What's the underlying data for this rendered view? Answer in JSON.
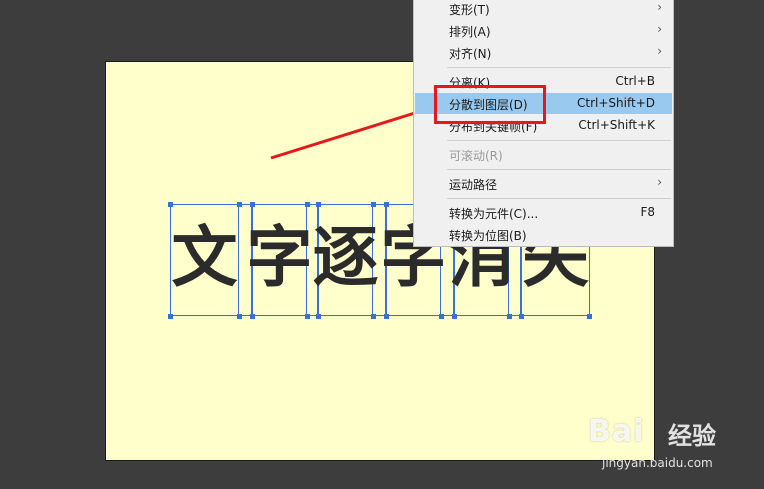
{
  "stage": {
    "text_chars": [
      "文",
      "字",
      "逐",
      "字",
      "消",
      "失"
    ]
  },
  "menu": {
    "items": [
      {
        "label": "变形(T)",
        "shortcut": "",
        "submenu": true
      },
      {
        "label": "排列(A)",
        "shortcut": "",
        "submenu": true
      },
      {
        "label": "对齐(N)",
        "shortcut": "",
        "submenu": true
      },
      {
        "label": "分离(K)",
        "shortcut": "Ctrl+B",
        "submenu": false
      },
      {
        "label": "分散到图层(D)",
        "shortcut": "Ctrl+Shift+D",
        "submenu": false,
        "highlighted": true
      },
      {
        "label": "分布到关键帧(F)",
        "shortcut": "Ctrl+Shift+K",
        "submenu": false
      },
      {
        "label": "可滚动(R)",
        "shortcut": "",
        "submenu": false,
        "disabled": true
      },
      {
        "label": "运动路径",
        "shortcut": "",
        "submenu": true
      },
      {
        "label": "转换为元件(C)...",
        "shortcut": "F8",
        "submenu": false
      },
      {
        "label": "转换为位图(B)",
        "shortcut": "",
        "submenu": false
      }
    ]
  },
  "watermark": {
    "logo": "Bai",
    "logo_tail": "经验",
    "url": "jingyan.baidu.com"
  },
  "colors": {
    "stage_bg": "#ffffcc",
    "highlight": "#99c9ef",
    "annotation": "#e21a1a",
    "selection": "#3b6fd6"
  }
}
